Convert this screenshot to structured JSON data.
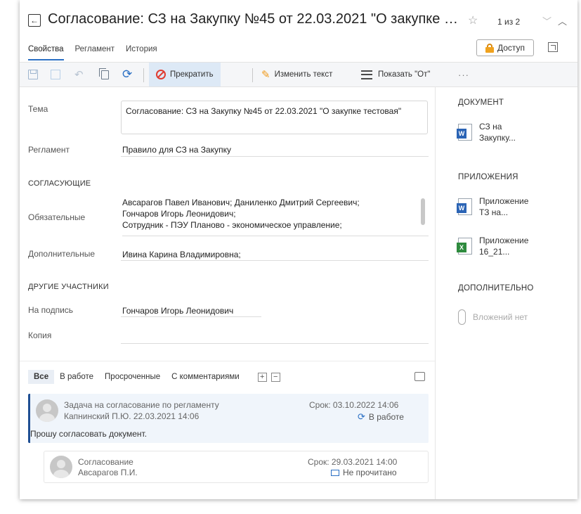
{
  "title": "Согласование: СЗ на Закупку №45 от 22.03.2021 \"О закупке те...",
  "pager": "1 из 2",
  "tabs": [
    "Свойства",
    "Регламент",
    "История"
  ],
  "access_label": "Доступ",
  "toolbar": {
    "stop_label": "Прекратить",
    "edit_text_label": "Изменить текст",
    "show_from_label": "Показать \"От\"",
    "more": "···"
  },
  "form": {
    "topic_label": "Тема",
    "topic_value": "Согласование: СЗ на Закупку №45 от 22.03.2021 \"О закупке тестовая\"",
    "reglament_label": "Регламент",
    "reglament_value": "Правило для СЗ на Закупку",
    "approvers_head": "СОГЛАСУЮЩИЕ",
    "required_label": "Обязательные",
    "required_lines": [
      "Авсарагов Павел Иванович; Даниленко Дмитрий Сергеевич;",
      "Гончаров Игорь Леонидович;",
      "Сотрудник - ПЭУ Планово - экономическое управление;"
    ],
    "additional_label": "Дополнительные",
    "additional_value": "Ивина Карина Владимировна;",
    "others_head": "ДРУГИЕ УЧАСТНИКИ",
    "sign_label": "На подпись",
    "sign_value": "Гончаров Игорь Леонидович",
    "copy_label": "Копия",
    "copy_value": ""
  },
  "right_panel": {
    "document_head": "ДОКУМЕНТ",
    "document": {
      "name": "СЗ на Закупку...",
      "type": "word"
    },
    "attachments_head": "ПРИЛОЖЕНИЯ",
    "attachments": [
      {
        "name": "Приложение ТЗ на...",
        "type": "word"
      },
      {
        "name": "Приложение 16_21...",
        "type": "excel"
      }
    ],
    "additional_head": "ДОПОЛНИТЕЛЬНО",
    "no_attachments": "Вложений нет"
  },
  "filters": [
    "Все",
    "В работе",
    "Просроченные",
    "С комментариями"
  ],
  "tasks": [
    {
      "title": "Задача на согласование по регламенту",
      "author": "Капнинский П.Ю.  22.03.2021 14:06",
      "due": "Срок: 03.10.2022 14:06",
      "status": "В работе",
      "comment": "Прошу согласовать документ."
    },
    {
      "title": "Согласование",
      "author": "Авсарагов П.И.",
      "due": "Срок: 29.03.2021 14:00",
      "status": "Не прочитано"
    }
  ],
  "colors": {
    "accent": "#2a6fc4",
    "stop": "#e03c31",
    "lock": "#f0a21e",
    "task_border": "#1f4f93"
  }
}
